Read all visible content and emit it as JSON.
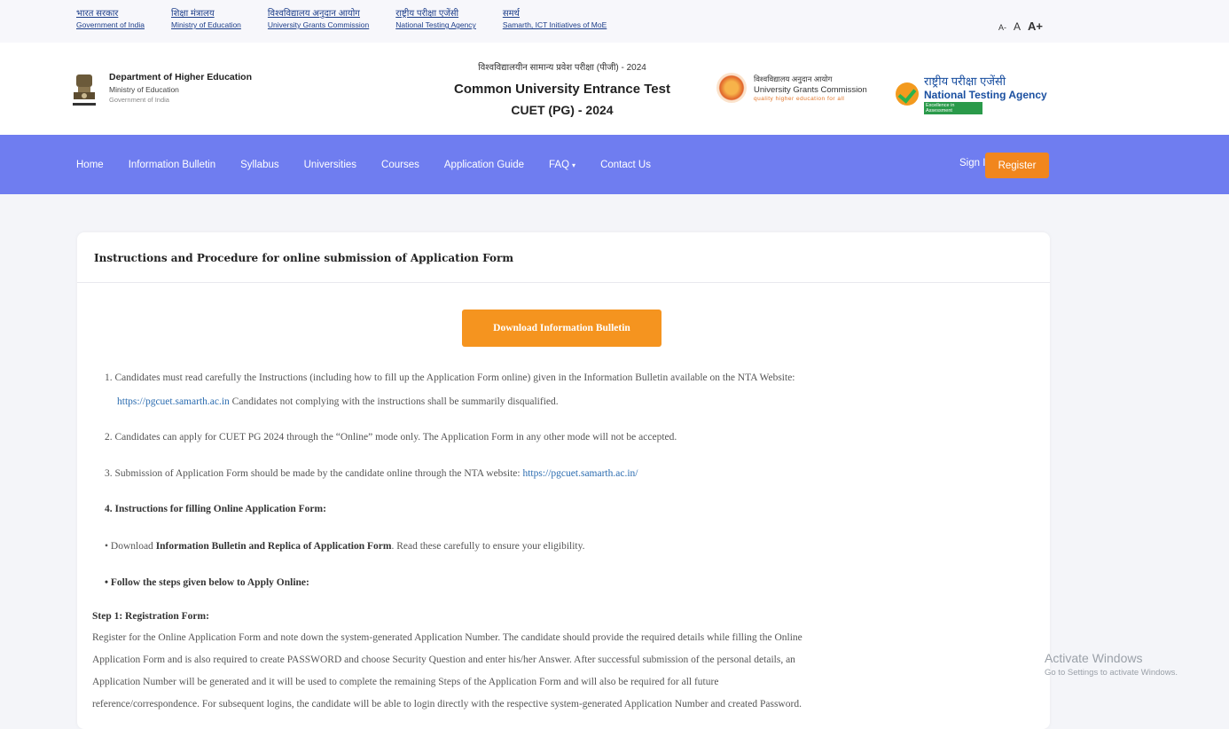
{
  "gov_links": [
    {
      "hindi": "भारत सरकार",
      "english": "Government of India"
    },
    {
      "hindi": "शिक्षा मंत्रालय",
      "english": "Ministry of Education"
    },
    {
      "hindi": "विश्वविद्यालय अनुदान आयोग",
      "english": "University Grants Commission"
    },
    {
      "hindi": "राष्ट्रीय परीक्षा एजेंसी",
      "english": "National Testing Agency"
    },
    {
      "hindi": "समर्थ",
      "english": "Samarth, ICT Initiatives of MoE"
    }
  ],
  "font_controls": {
    "small": "A-",
    "medium": "A",
    "large": "A+"
  },
  "header": {
    "dept_title": "Department of Higher Education",
    "dept_ministry": "Ministry of Education",
    "dept_gov": "Government of India",
    "hindi_title": "विश्वविद्यालयीन सामान्य प्रवेश परीक्षा (पीजी) - 2024",
    "title": "Common University Entrance Test",
    "subtitle": "CUET (PG) - 2024",
    "ugc_hindi": "विश्वविद्यालय अनुदान आयोग",
    "ugc_english": "University Grants Commission",
    "ugc_tagline": "quality higher education for all",
    "nta_hindi": "राष्ट्रीय परीक्षा एजेंसी",
    "nta_english": "National Testing Agency",
    "nta_tagline": "Excellence in Assessment"
  },
  "nav": {
    "items": [
      "Home",
      "Information Bulletin",
      "Syllabus",
      "Universities",
      "Courses",
      "Application Guide",
      "FAQ",
      "Contact Us"
    ],
    "faq_caret": "▾",
    "signin": "Sign In",
    "register": "Register"
  },
  "card": {
    "title": "Instructions and Procedure for online submission of Application Form",
    "download_button": "Download Information Bulletin",
    "item1_a": "1. Candidates must read carefully the Instructions (including how to fill up the Application Form online) given in the Information Bulletin available on the NTA Website:",
    "item1_link": "https://pgcuet.samarth.ac.in",
    "item1_b": " Candidates not complying with the instructions shall be summarily disqualified.",
    "item2": "2. Candidates can apply for CUET PG 2024 through the “Online” mode only. The Application Form in any other mode will not be accepted.",
    "item3_a": "3. Submission of Application Form should be made by the candidate online through the NTA website: ",
    "item3_link": "https://pgcuet.samarth.ac.in/",
    "item4": "4. Instructions for filling Online Application Form:",
    "bullet1_a": "• Download ",
    "bullet1_bold": "Information Bulletin and Replica of Application Form",
    "bullet1_b": ". Read these carefully to ensure your eligibility.",
    "bullet2": "• Follow the steps given below to Apply Online:",
    "step1_title": "Step 1: Registration Form:",
    "step1_l1": "Register for the Online Application Form and note down the system-generated Application Number. The candidate should provide the required details while filling the Online",
    "step1_l2": "Application Form and is also required to create PASSWORD and choose Security Question and enter his/her Answer. After successful submission of the personal details, an",
    "step1_l3": "Application Number will be generated and it will be used to complete the remaining Steps of the Application Form and will also be required for all future",
    "step1_l4": "reference/correspondence. For subsequent logins, the candidate will be able to login directly with the respective system-generated Application Number and created Password."
  },
  "watermark": {
    "line1": "Activate Windows",
    "line2": "Go to Settings to activate Windows."
  }
}
